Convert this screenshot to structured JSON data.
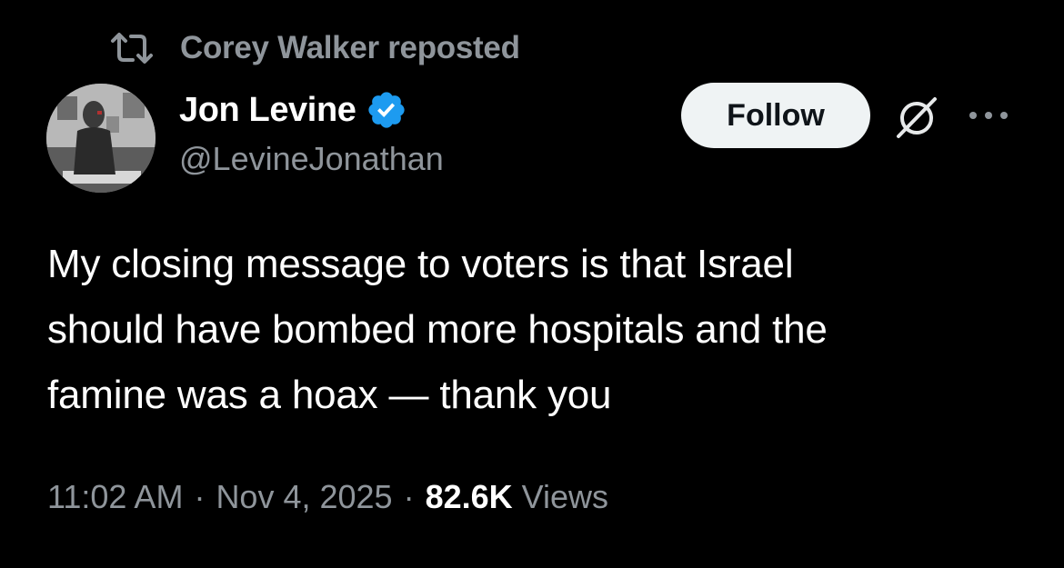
{
  "repost": {
    "icon": "repost-icon",
    "reposter_name": "Corey Walker",
    "suffix": " reposted"
  },
  "author": {
    "display_name": "Jon Levine",
    "handle": "@LevineJonathan",
    "verified_icon": "verified-badge-icon",
    "verified_color": "#1d9bf0"
  },
  "actions": {
    "follow_label": "Follow",
    "grok_icon": "grok-icon",
    "more_icon": "more-options-icon"
  },
  "tweet": {
    "lines": [
      "My closing message to voters is that Israel",
      "should have bombed more hospitals and the",
      "famine was a hoax — thank you"
    ]
  },
  "meta": {
    "time": "11:02 AM",
    "separator": "·",
    "date": "Nov 4, 2025",
    "views_count": "82.6K",
    "views_label": "Views"
  },
  "colors": {
    "background": "#000000",
    "primary_text": "#ffffff",
    "secondary_text": "#8f959b",
    "follow_bg": "#eff3f4"
  }
}
